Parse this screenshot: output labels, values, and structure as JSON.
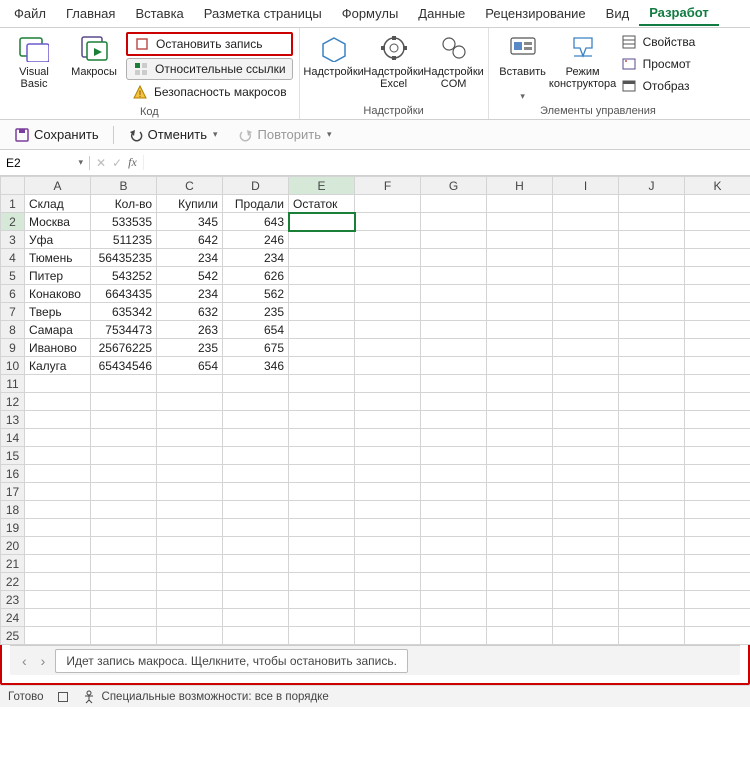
{
  "tabs": [
    "Файл",
    "Главная",
    "Вставка",
    "Разметка страницы",
    "Формулы",
    "Данные",
    "Рецензирование",
    "Вид",
    "Разработ"
  ],
  "active_tab_index": 8,
  "ribbon": {
    "group_code": {
      "label": "Код",
      "visual_basic": "Visual Basic",
      "macros": "Макросы",
      "stop_recording": "Остановить запись",
      "relative_refs": "Относительные ссылки",
      "macro_security": "Безопасность макросов"
    },
    "group_addins": {
      "label": "Надстройки",
      "addins": "Надстройки",
      "excel_addins": "Надстройки Excel",
      "com_addins": "Надстройки COM"
    },
    "group_controls": {
      "label": "Элементы управления",
      "insert": "Вставить",
      "design_mode": "Режим конструктора",
      "properties": "Свойства",
      "view_code": "Просмот",
      "display": "Отобраз"
    }
  },
  "qat": {
    "save": "Сохранить",
    "undo": "Отменить",
    "redo": "Повторить"
  },
  "namebox": "E2",
  "grid": {
    "cols": [
      "A",
      "B",
      "C",
      "D",
      "E",
      "F",
      "G",
      "H",
      "I",
      "J",
      "K"
    ],
    "headers": [
      "Склад",
      "Кол-во",
      "Купили",
      "Продали",
      "Остаток"
    ],
    "rows": [
      {
        "r": 2,
        "c": [
          "Москва",
          "533535",
          "345",
          "643",
          ""
        ]
      },
      {
        "r": 3,
        "c": [
          "Уфа",
          "511235",
          "642",
          "246",
          ""
        ]
      },
      {
        "r": 4,
        "c": [
          "Тюмень",
          "56435235",
          "234",
          "234",
          ""
        ]
      },
      {
        "r": 5,
        "c": [
          "Питер",
          "543252",
          "542",
          "626",
          ""
        ]
      },
      {
        "r": 6,
        "c": [
          "Конаково",
          "6643435",
          "234",
          "562",
          ""
        ]
      },
      {
        "r": 7,
        "c": [
          "Тверь",
          "635342",
          "632",
          "235",
          ""
        ]
      },
      {
        "r": 8,
        "c": [
          "Самара",
          "7534473",
          "263",
          "654",
          ""
        ]
      },
      {
        "r": 9,
        "c": [
          "Иваново",
          "25676225",
          "235",
          "675",
          ""
        ]
      },
      {
        "r": 10,
        "c": [
          "Калуга",
          "65434546",
          "654",
          "346",
          ""
        ]
      }
    ],
    "empty_rows": [
      11,
      12,
      13,
      14,
      15,
      16,
      17,
      18,
      19,
      20,
      21,
      22,
      23,
      24,
      25
    ],
    "selected": {
      "row": 2,
      "col": "E"
    }
  },
  "tooltip": "Идет запись макроса. Щелкните, чтобы остановить запись.",
  "status": {
    "ready": "Готово",
    "accessibility": "Специальные возможности: все в порядке"
  }
}
